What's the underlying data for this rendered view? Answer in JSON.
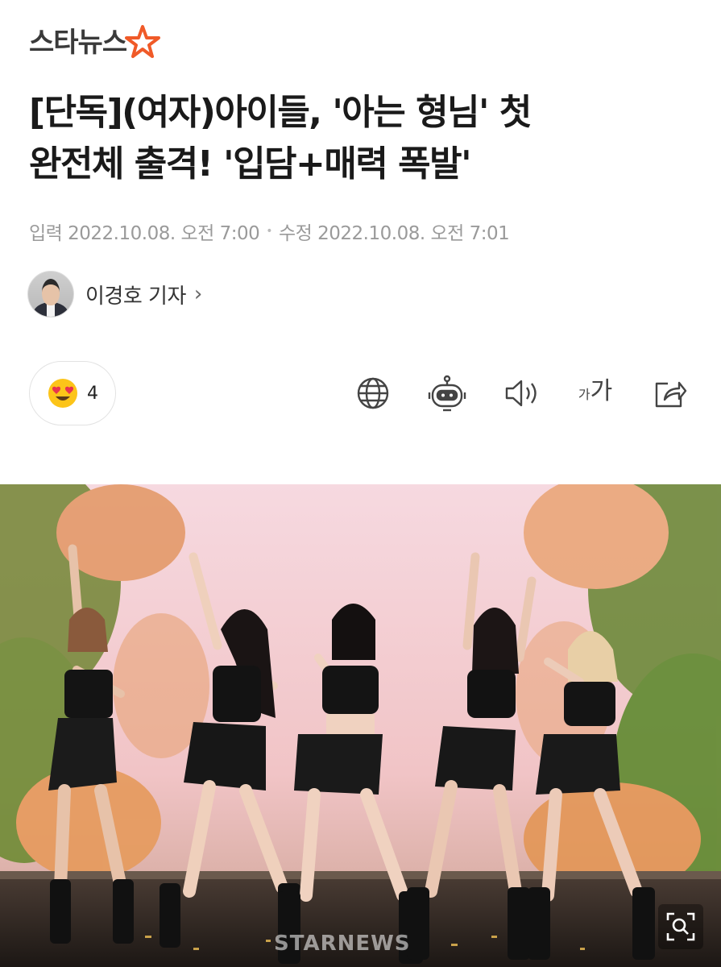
{
  "header": {
    "logo_text": "스타뉴스",
    "logo_star_colors": [
      "#f05a28",
      "#f7931e"
    ]
  },
  "article": {
    "headline_line1": "[단독](여자)아이들, '아는 형님' 첫",
    "headline_line2": "완전체 출격! '입담+매력 폭발'",
    "published_label": "입력",
    "published_at": "2022.10.08. 오전 7:00",
    "separator": "•",
    "modified_label": "수정",
    "modified_at": "2022.10.08. 오전 7:01",
    "author_name": "이경호 기자",
    "author_chevron": "›"
  },
  "actions": {
    "reaction_emoji": "heart-eyes-emoji",
    "reaction_count": "4",
    "icons": [
      "globe-icon",
      "robot-icon",
      "speaker-icon",
      "font-size-icon",
      "share-icon"
    ],
    "font_small": "가",
    "font_big": "가"
  },
  "photo": {
    "watermark": "STARNEWS",
    "zoom_icon": "zoom-icon"
  },
  "colors": {
    "accent_orange": "#f05a28",
    "text_dark": "#1a1a1a",
    "text_gray": "#9a9a9a",
    "reaction_yellow": "#fcc419"
  }
}
